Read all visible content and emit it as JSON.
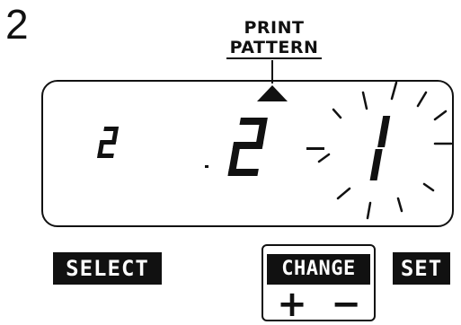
{
  "step": {
    "number": "2"
  },
  "display": {
    "label_line1": "PRINT",
    "label_line2": "PATTERN",
    "digits": [
      "2",
      "2",
      "1"
    ]
  },
  "buttons": {
    "select": "SELECT",
    "change": "CHANGE",
    "plus": "+",
    "minus": "−",
    "set": "SET"
  }
}
